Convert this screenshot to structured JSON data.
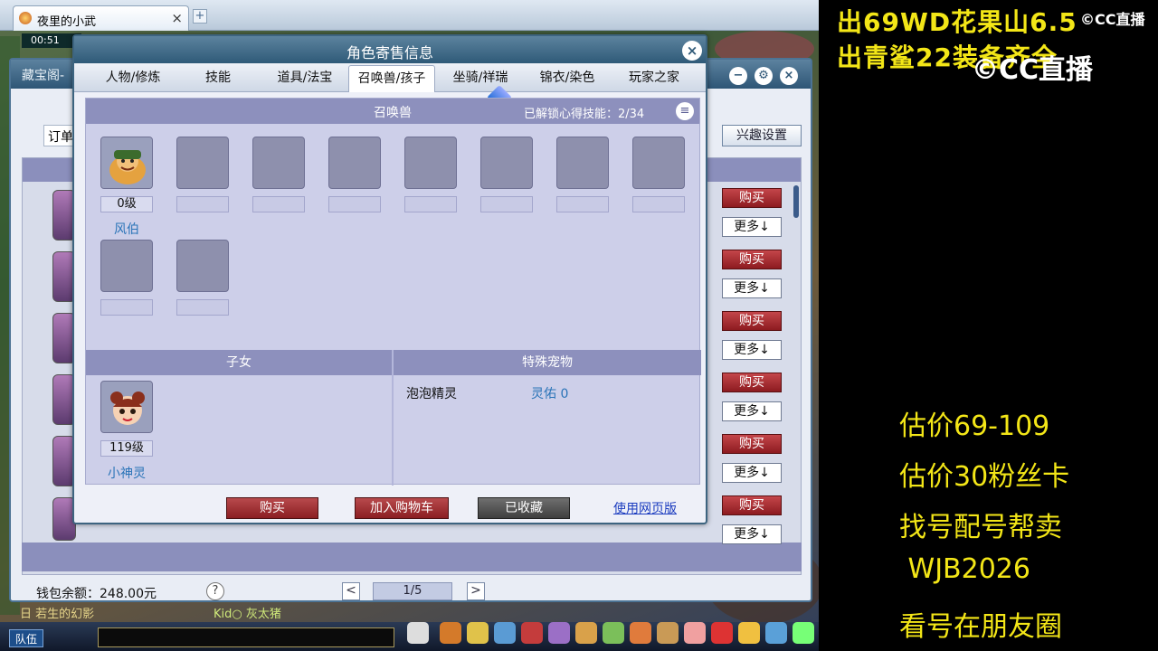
{
  "browser": {
    "tab_title": "夜里的小武",
    "close_glyph": "×",
    "new_tab_glyph": "+"
  },
  "game": {
    "clock": "00:51",
    "team_button": "队伍",
    "chat_line_1": "日 若生的幻影",
    "chat_line_2": "Kid○ 灰太猪"
  },
  "base_window": {
    "title": "藏宝阁-",
    "filter_label": "订单",
    "interest_button": "兴趣设置",
    "buy_label": "购买",
    "more_label": "更多↓",
    "wallet": "钱包余额：248.00元",
    "help": "?",
    "page_prev": "<",
    "page_next": ">",
    "page_indicator": "1/5"
  },
  "modal": {
    "title": "角色寄售信息",
    "close": "×",
    "tabs": [
      "人物/修炼",
      "技能",
      "道具/法宝",
      "召唤兽/孩子",
      "坐骑/祥瑞",
      "锦衣/染色",
      "玩家之家"
    ],
    "active_tab_index": 3,
    "summon": {
      "title": "召唤兽",
      "skills_label": "已解锁心得技能：2/34",
      "skills_icon": "list-icon",
      "pets": [
        {
          "level": "0级",
          "name": "风伯"
        }
      ]
    },
    "children": {
      "title": "子女",
      "items": [
        {
          "level": "119级",
          "name": "小神灵"
        }
      ]
    },
    "special_pets": {
      "title": "特殊宠物",
      "items": [
        {
          "name": "泡泡精灵",
          "blessing": "灵佑 0"
        }
      ]
    },
    "actions": {
      "buy": "购买",
      "add_to_cart": "加入购物车",
      "favorited": "已收藏",
      "web_version": "使用网页版"
    }
  },
  "overlay": {
    "headline_1": "出69WD花果山6.5",
    "headline_2": "出青鲨22装备齐全",
    "logo_small": "©CC直播",
    "logo_big": "©CC直播",
    "notes": [
      "估价69-109",
      "估价30粉丝卡",
      "找号配号帮卖",
      " WJB2026",
      "看号在朋友圈"
    ]
  }
}
